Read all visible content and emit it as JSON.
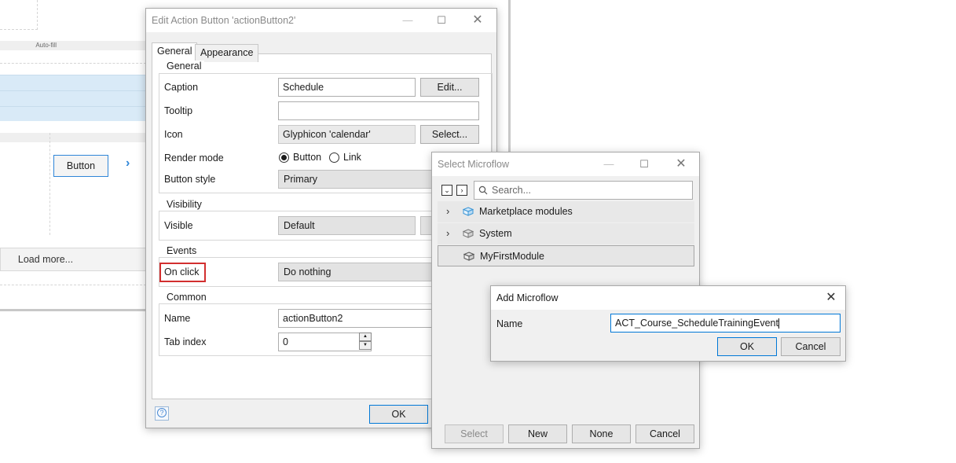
{
  "background": {
    "autofill_label": "Auto-fill",
    "canvas_button_label": "Button",
    "load_more_label": "Load more..."
  },
  "edit_dialog": {
    "title": "Edit Action Button 'actionButton2'",
    "tabs": [
      "General",
      "Appearance"
    ],
    "groups": {
      "general": "General",
      "visibility": "Visibility",
      "events": "Events",
      "common": "Common"
    },
    "labels": {
      "caption": "Caption",
      "tooltip": "Tooltip",
      "icon": "Icon",
      "render_mode": "Render mode",
      "button_style": "Button style",
      "visible": "Visible",
      "on_click": "On click",
      "name": "Name",
      "tab_index": "Tab index"
    },
    "values": {
      "caption": "Schedule",
      "tooltip": "",
      "icon": "Glyphicon 'calendar'",
      "render_mode_button": "Button",
      "render_mode_link": "Link",
      "button_style": "Primary",
      "visible": "Default",
      "on_click": "Do nothing",
      "name": "actionButton2",
      "tab_index": "0"
    },
    "buttons": {
      "edit": "Edit...",
      "select": "Select...",
      "ok": "OK"
    }
  },
  "select_dialog": {
    "title": "Select Microflow",
    "search_placeholder": "Search...",
    "tree": [
      {
        "label": "Marketplace modules",
        "expandable": true
      },
      {
        "label": "System",
        "expandable": true
      },
      {
        "label": "MyFirstModule",
        "expandable": false
      }
    ],
    "buttons": {
      "select": "Select",
      "new": "New",
      "none": "None",
      "cancel": "Cancel"
    }
  },
  "add_dialog": {
    "title": "Add Microflow",
    "name_label": "Name",
    "name_value": "ACT_Course_ScheduleTrainingEvent",
    "ok": "OK",
    "cancel": "Cancel"
  },
  "colors": {
    "accent": "#0078d7",
    "highlight": "#d22f2f",
    "selection_band": "#d9eaf7"
  }
}
